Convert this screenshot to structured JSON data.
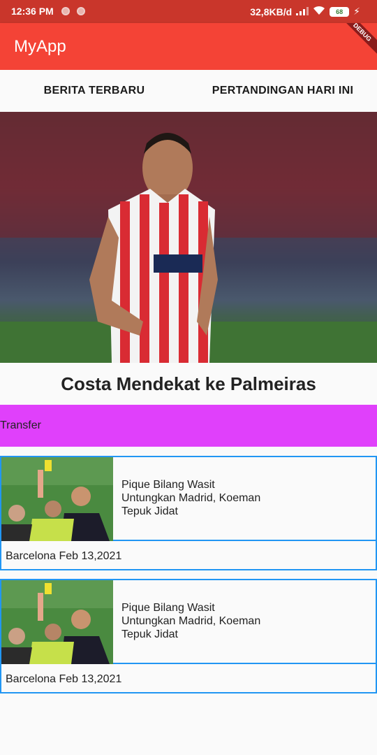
{
  "status_bar": {
    "time": "12:36 PM",
    "network_speed": "32,8KB/d",
    "battery": "68"
  },
  "app_bar": {
    "title": "MyApp",
    "debug_label": "DEBUG"
  },
  "tabs": [
    {
      "label": "BERITA TERBARU"
    },
    {
      "label": "PERTANDINGAN HARI INI"
    }
  ],
  "featured": {
    "headline": "Costa Mendekat ke Palmeiras",
    "category": "Transfer"
  },
  "news": [
    {
      "title": "Pique Bilang Wasit Untungkan Madrid, Koeman Tepuk Jidat",
      "meta": "Barcelona Feb 13,2021"
    },
    {
      "title": "Pique Bilang Wasit Untungkan Madrid, Koeman Tepuk Jidat",
      "meta": "Barcelona Feb 13,2021"
    }
  ],
  "colors": {
    "app_bar": "#f44336",
    "status_bar": "#c9362b",
    "category_bg": "#e040fb",
    "card_border": "#2196f3"
  }
}
